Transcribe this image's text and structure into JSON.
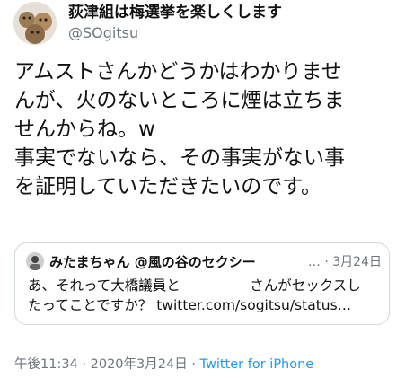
{
  "tweet": {
    "author": {
      "display_name": "荻津組は梅選挙を楽しくします",
      "handle": "@SOgitsu"
    },
    "text_lines": [
      "アムストさんかどうかはわかりませ",
      "んが、火のないところに煙は立ちま",
      "せんからね。w",
      "事実でないなら、その事実がない事",
      "を証明していただきたいのです。"
    ],
    "quoted": {
      "author_name": "みたまちゃん @風の谷のセクシー",
      "ellipsis": "…",
      "separator": "·",
      "date": "3月24日",
      "text_lines": [
        "あ、それって大橋議員と　　　　　さんがセックスし",
        "たってことですか？ twitter.com/sogitsu/status…"
      ]
    },
    "footer": {
      "time": "午後11:34",
      "separator": "·",
      "date": "2020年3月24日",
      "separator2": "·",
      "source": "Twitter for iPhone"
    }
  },
  "icons": {
    "avatar": "avatar-icon",
    "quoted_avatar": "avatar-icon"
  },
  "colors": {
    "text": "#111111",
    "secondary": "#6e767d",
    "link": "#1d9bf0",
    "border": "#cfd9de"
  }
}
